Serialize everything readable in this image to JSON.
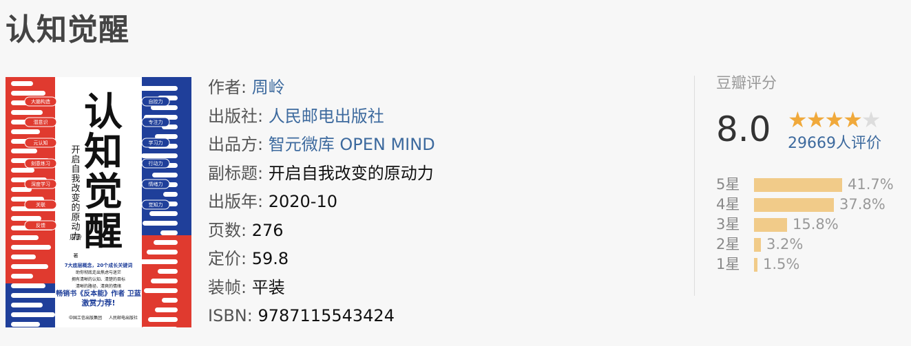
{
  "book": {
    "title": "认知觉醒"
  },
  "cover": {
    "title_chars": [
      "认",
      "知",
      "觉",
      "醒"
    ],
    "subtitle": "开启自我改变的原动力",
    "author": "周岭",
    "author_suffix": "著",
    "left_tags": [
      "大脑构造",
      "潜意识",
      "元认知",
      "刻意练习",
      "深度学习",
      "关联",
      "反馈"
    ],
    "right_tags": [
      "自控力",
      "专注力",
      "学习力",
      "行动力",
      "情绪力",
      "觉知力"
    ],
    "blurb_lines": [
      "7大底层概念，20个成长关键词",
      "助你彻底走出焦虑与迷茫",
      "拥有清晰的认知、清楚的目标",
      "清晰的路径、清爽的情绪"
    ],
    "promo_line1": "畅销书《反本能》作者 卫蓝",
    "promo_line2": "激赏力荐!",
    "publisher_logo_1": "中国工信出版集团",
    "publisher_logo_2": "人民邮电出版社",
    "colors": {
      "red": "#e03a2f",
      "blue": "#1f3f9a",
      "white": "#ffffff",
      "black": "#111111"
    }
  },
  "info": [
    {
      "label": "作者:",
      "value": "周岭",
      "link": true
    },
    {
      "label": "出版社:",
      "value": "人民邮电出版社",
      "link": true
    },
    {
      "label": "出品方:",
      "value": "智元微库 OPEN MIND",
      "link": true
    },
    {
      "label": "副标题:",
      "value": "开启自我改变的原动力",
      "link": false
    },
    {
      "label": "出版年:",
      "value": "2020-10",
      "link": false
    },
    {
      "label": "页数:",
      "value": "276",
      "link": false
    },
    {
      "label": "定价:",
      "value": "59.8",
      "link": false
    },
    {
      "label": "装帧:",
      "value": "平装",
      "link": false
    },
    {
      "label": "ISBN:",
      "value": "9787115543424",
      "link": false
    }
  ],
  "rating": {
    "label": "豆瓣评分",
    "score": "8.0",
    "stars_filled": 4,
    "stars_total": 5,
    "count_text": "29669人评价",
    "star_color": "#f0a93b",
    "bar_color": "#f1cb89",
    "distribution": [
      {
        "label": "5星",
        "percent": 41.7,
        "text": "41.7%"
      },
      {
        "label": "4星",
        "percent": 37.8,
        "text": "37.8%"
      },
      {
        "label": "3星",
        "percent": 15.8,
        "text": "15.8%"
      },
      {
        "label": "2星",
        "percent": 3.2,
        "text": "3.2%"
      },
      {
        "label": "1星",
        "percent": 1.5,
        "text": "1.5%"
      }
    ]
  }
}
